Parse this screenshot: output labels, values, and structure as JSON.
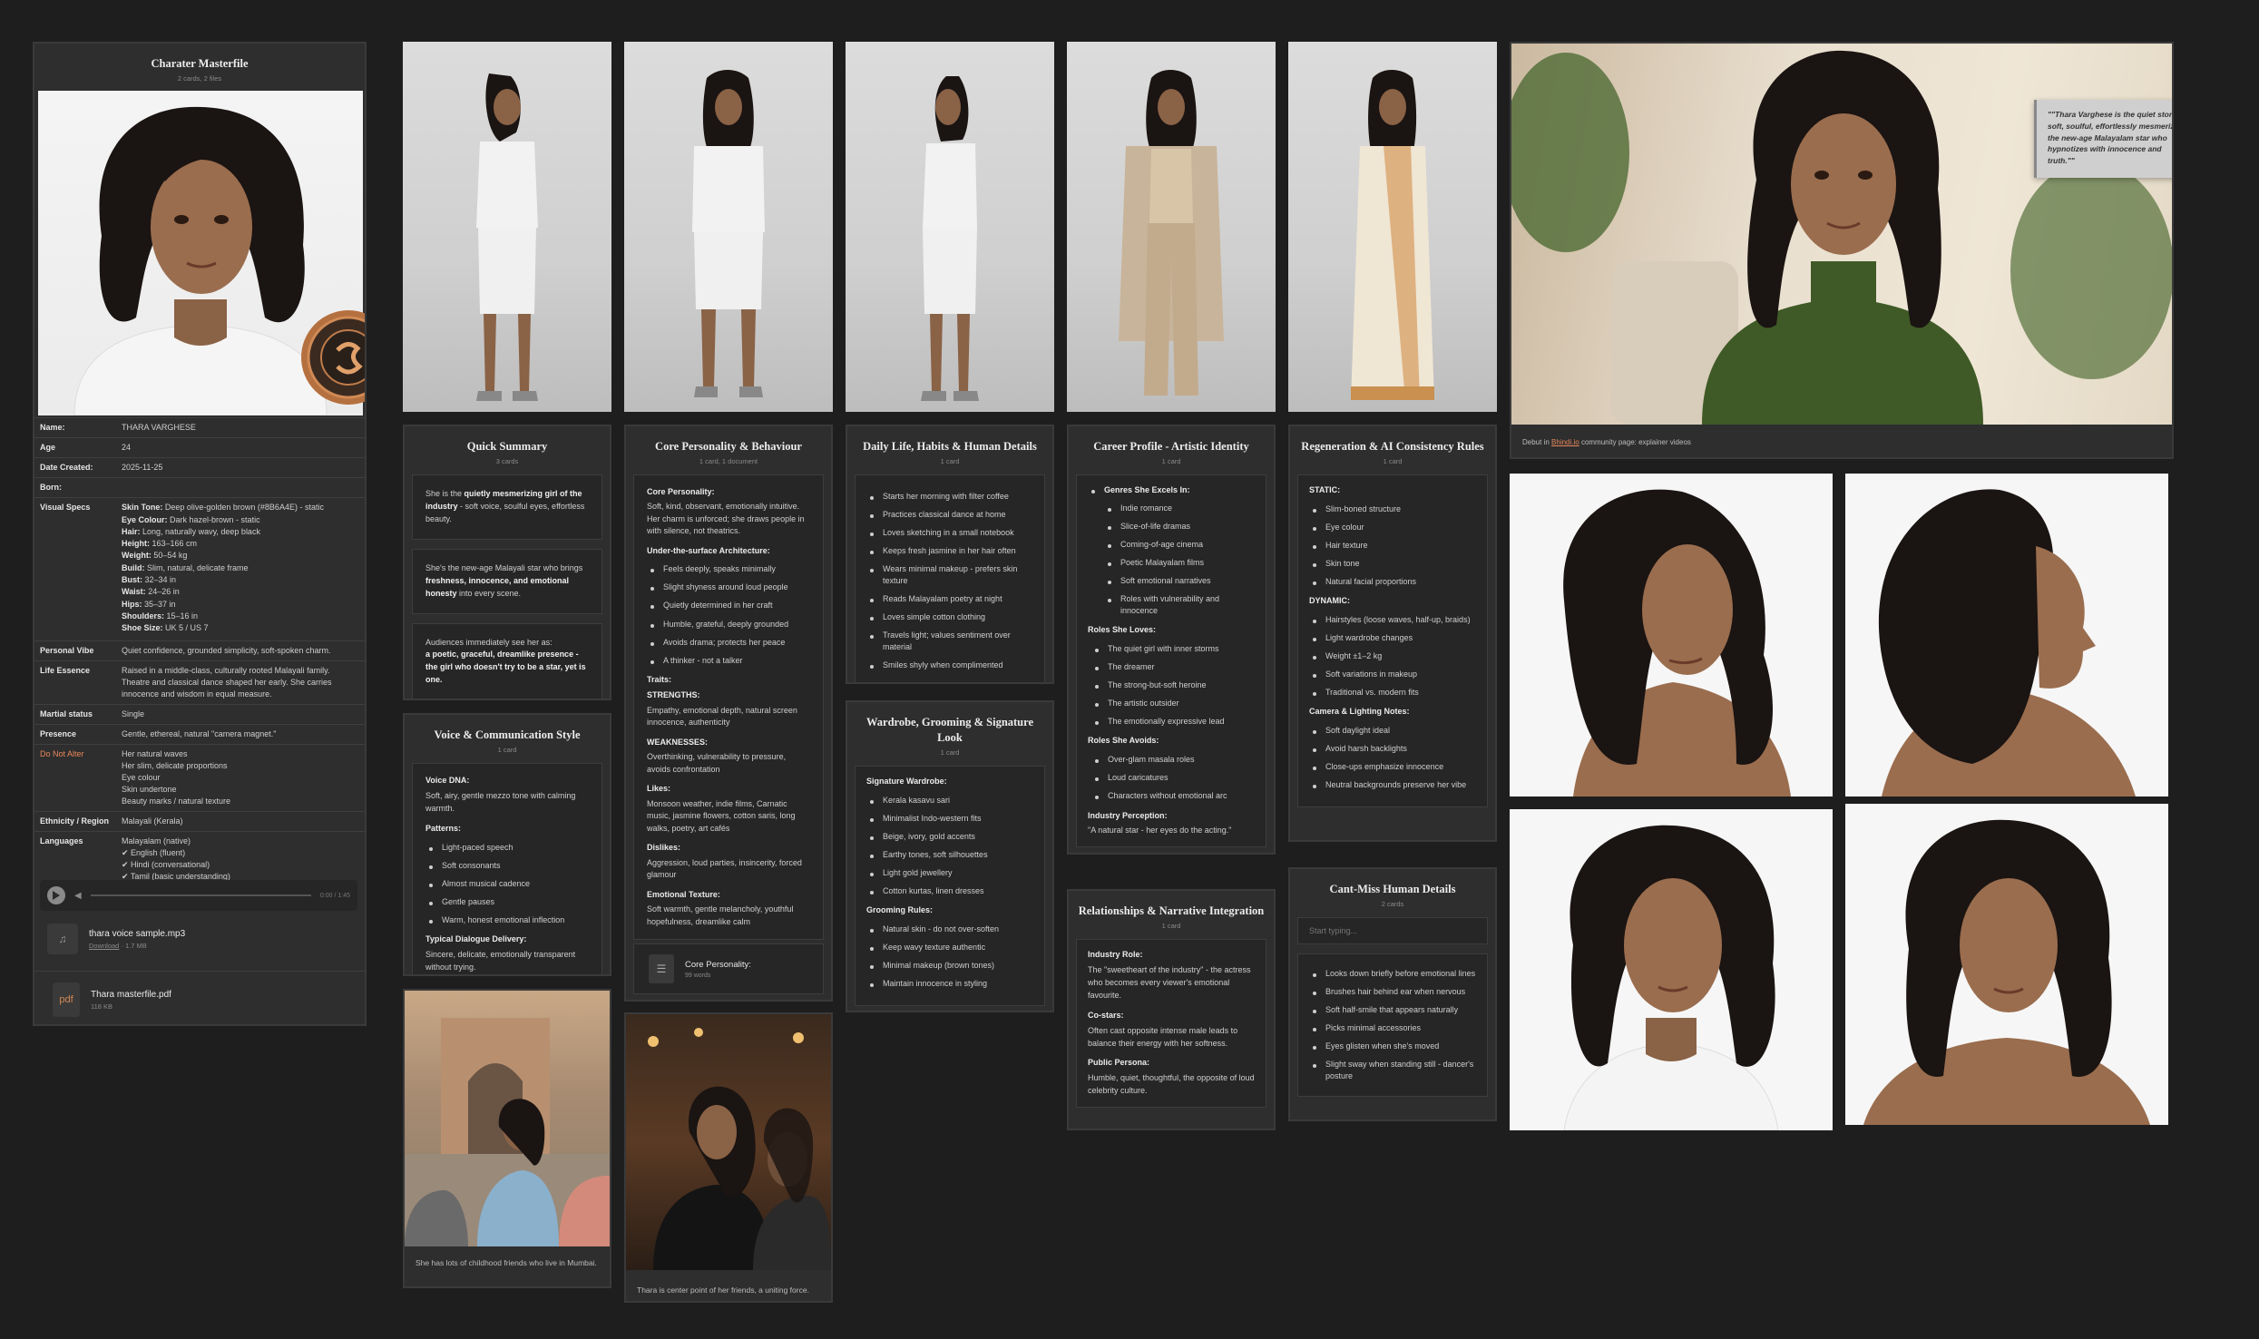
{
  "masterfile": {
    "title": "Charater Masterfile",
    "subtitle": "2 cards, 2 files",
    "fields": [
      {
        "k": "Name:",
        "v": "THARA VARGHESE"
      },
      {
        "k": "Age",
        "v": "24"
      },
      {
        "k": "Date Created:",
        "v": "2025-11-25"
      },
      {
        "k": "Born:",
        "v": ""
      },
      {
        "k": "Visual Specs",
        "v": ""
      },
      {
        "k": "Personal Vibe",
        "v": "Quiet confidence, grounded simplicity, soft-spoken charm."
      },
      {
        "k": "Life Essence",
        "v": "Raised in a middle-class, culturally rooted Malayali family. Theatre and classical dance shaped her early. She carries innocence and wisdom in equal measure."
      },
      {
        "k": "Martial status",
        "v": "Single"
      },
      {
        "k": "Presence",
        "v": "Gentle, ethereal, natural \"camera magnet.\""
      },
      {
        "k": "Do Not Alter",
        "v": ""
      },
      {
        "k": "Ethnicity / Region",
        "v": "Malayali (Kerala)"
      },
      {
        "k": "Languages",
        "v": ""
      }
    ],
    "visual_specs": [
      {
        "k": "Skin Tone:",
        "v": "Deep olive-golden brown (#8B6A4E) - static"
      },
      {
        "k": "Eye Colour:",
        "v": "Dark hazel-brown - static"
      },
      {
        "k": "Hair:",
        "v": "Long, naturally wavy, deep black"
      },
      {
        "k": "Height:",
        "v": "163–166 cm"
      },
      {
        "k": "Weight:",
        "v": "50–54 kg"
      },
      {
        "k": "Build:",
        "v": "Slim, natural, delicate frame"
      },
      {
        "k": "Bust:",
        "v": "32–34 in"
      },
      {
        "k": "Waist:",
        "v": "24–26 in"
      },
      {
        "k": "Hips:",
        "v": "35–37 in"
      },
      {
        "k": "Shoulders:",
        "v": "15–16 in"
      },
      {
        "k": "Shoe Size:",
        "v": "UK 5 / US 7"
      }
    ],
    "do_not_alter": [
      "Her natural waves",
      "Her slim, delicate proportions",
      "Eye colour",
      "Skin undertone",
      "Beauty marks / natural texture"
    ],
    "languages": [
      "Malayalam (native)",
      "✔ English (fluent)",
      "✔ Hindi (conversational)",
      "✔ Tamil (basic understanding)"
    ],
    "audio_time": "0:00 / 1:45",
    "audio_file": {
      "name": "thara voice sample.mp3",
      "download": "Download",
      "size": "1.7 MB"
    },
    "pdf_file": {
      "icon": "pdf",
      "name": "Thara masterfile.pdf",
      "size": "118 KB"
    }
  },
  "quick_summary": {
    "title": "Quick Summary",
    "subtitle": "3 cards",
    "c1_a": "She is the ",
    "c1_b": "quietly mesmerizing girl of the industry",
    "c1_c": " - soft voice, soulful eyes, effortless beauty.",
    "c2_a": "She's the new-age Malayali star who brings ",
    "c2_b": "freshness, innocence, and emotional honesty",
    "c2_c": " into every scene.",
    "c3_a": "Audiences immediately see her as:",
    "c3_b": "a poetic, graceful, dreamlike presence - the girl who doesn't try to be a star, yet is one."
  },
  "voice": {
    "title": "Voice & Communication Style",
    "subtitle": "1 card",
    "dna_h": "Voice DNA:",
    "dna": "Soft, airy, gentle mezzo tone with calming warmth.",
    "patterns_h": "Patterns:",
    "patterns": [
      "Light-paced speech",
      "Soft consonants",
      "Almost musical cadence",
      "Gentle pauses",
      "Warm, honest emotional inflection"
    ],
    "dialogue_h": "Typical Dialogue Delivery:",
    "dialogue": "Sincere, delicate, emotionally transparent without trying."
  },
  "photo_caption_1": "She has lots of childhood friends who live in Mumbai.",
  "core": {
    "title": "Core Personality & Behaviour",
    "subtitle": "1 card, 1 document",
    "h1": "Core Personality:",
    "p1": "Soft, kind, observant, emotionally intuitive. Her charm is unforced; she draws people in with silence, not theatrics.",
    "h2": "Under-the-surface Architecture:",
    "arch": [
      "Feels deeply, speaks minimally",
      "Slight shyness around loud people",
      "Quietly determined in her craft",
      "Humble, grateful, deeply grounded",
      "Avoids drama; protects her peace",
      "A thinker - not a talker"
    ],
    "h3": "Traits:",
    "s_h": "STRENGTHS:",
    "s": "Empathy, emotional depth, natural screen innocence, authenticity",
    "w_h": "WEAKNESSES:",
    "w": "Overthinking, vulnerability to pressure, avoids confrontation",
    "likes_h": "Likes:",
    "likes": "Monsoon weather, indie films, Carnatic music, jasmine flowers, cotton saris, long walks, poetry, art cafés",
    "dislikes_h": "Dislikes:",
    "dislikes": "Aggression, loud parties, insincerity, forced glamour",
    "emo_h": "Emotional Texture:",
    "emo": "Soft warmth, gentle melancholy, youthful hopefulness, dreamlike calm",
    "doc_name": "Core Personality:",
    "doc_meta": "99 words"
  },
  "photo_caption_2": "Thara is center point of her friends, a uniting force.",
  "daily": {
    "title": "Daily Life, Habits & Human Details",
    "subtitle": "1 card",
    "items": [
      "Starts her morning with filter coffee",
      "Practices classical dance at home",
      "Loves sketching in a small notebook",
      "Keeps fresh jasmine in her hair often",
      "Wears minimal makeup - prefers skin texture",
      "Reads Malayalam poetry at night",
      "Loves simple cotton clothing",
      "Travels light; values sentiment over material",
      "Smiles shyly when complimented"
    ]
  },
  "wardrobe": {
    "title": "Wardrobe, Grooming & Signature Look",
    "subtitle": "1 card",
    "h1": "Signature Wardrobe:",
    "w": [
      "Kerala kasavu sari",
      "Minimalist Indo-western fits",
      "Beige, ivory, gold accents",
      "Earthy tones, soft silhouettes",
      "Light gold jewellery",
      "Cotton kurtas, linen dresses"
    ],
    "h2": "Grooming Rules:",
    "g": [
      "Natural skin - do not over-soften",
      "Keep wavy texture authentic",
      "Minimal makeup (brown tones)",
      "Maintain innocence in styling"
    ]
  },
  "career": {
    "title": "Career Profile - Artistic Identity",
    "subtitle": "1 card",
    "h1": "Genres She Excels In:",
    "genres": [
      "Indie romance",
      "Slice-of-life dramas",
      "Coming-of-age cinema",
      "Poetic Malayalam films",
      "Soft emotional narratives",
      "Roles with vulnerability and innocence"
    ],
    "h2": "Roles She Loves:",
    "loves": [
      "The quiet girl with inner storms",
      "The dreamer",
      "The strong-but-soft heroine",
      "The artistic outsider",
      "The emotionally expressive lead"
    ],
    "h3": "Roles She Avoids:",
    "avoids": [
      "Over-glam masala roles",
      "Loud caricatures",
      "Characters without emotional arc"
    ],
    "h4": "Industry Perception:",
    "perception": "\"A natural star - her eyes do the acting.\""
  },
  "relationships": {
    "title": "Relationships & Narrative Integration",
    "subtitle": "1 card",
    "h1": "Industry Role:",
    "p1": "The \"sweetheart of the industry\" - the actress who becomes every viewer's emotional favourite.",
    "h2": "Co-stars:",
    "p2": "Often cast opposite intense male leads to balance their energy with her softness.",
    "h3": "Public Persona:",
    "p3": "Humble, quiet, thoughtful, the opposite of loud celebrity culture."
  },
  "regen": {
    "title": "Regeneration & AI Consistency Rules",
    "subtitle": "1 card",
    "h1": "STATIC:",
    "static": [
      "Slim-boned structure",
      "Eye colour",
      "Hair texture",
      "Skin tone",
      "Natural facial proportions"
    ],
    "h2": "DYNAMIC:",
    "dynamic": [
      "Hairstyles (loose waves, half-up, braids)",
      "Light wardrobe changes",
      "Weight ±1–2 kg",
      "Soft variations in makeup",
      "Traditional vs. modern fits"
    ],
    "h3": "Camera & Lighting Notes:",
    "camera": [
      "Soft daylight ideal",
      "Avoid harsh backlights",
      "Close-ups emphasize innocence",
      "Neutral backgrounds preserve her vibe"
    ]
  },
  "cant_miss": {
    "title": "Cant-Miss Human Details",
    "subtitle": "2 cards",
    "placeholder": "Start typing...",
    "items": [
      "Looks down briefly before emotional lines",
      "Brushes hair behind ear when nervous",
      "Soft half-smile that appears naturally",
      "Picks minimal accessories",
      "Eyes glisten when she's moved",
      "Slight sway when standing still - dancer's posture"
    ]
  },
  "hero": {
    "quote": "\"\"Thara Varghese is the quiet storm - soft, soulful, effortlessly mesmerizing, the new-age Malayalam star who hypnotizes with innocence and truth.\"\"",
    "caption_a": "Debut in ",
    "caption_link": "Bhindi.io",
    "caption_b": " community page: explainer videos"
  },
  "colors": {
    "bg": "#1e1e1e",
    "card": "#2e2e2e",
    "accent": "#e8875a",
    "skin": "#8B6A4E"
  }
}
